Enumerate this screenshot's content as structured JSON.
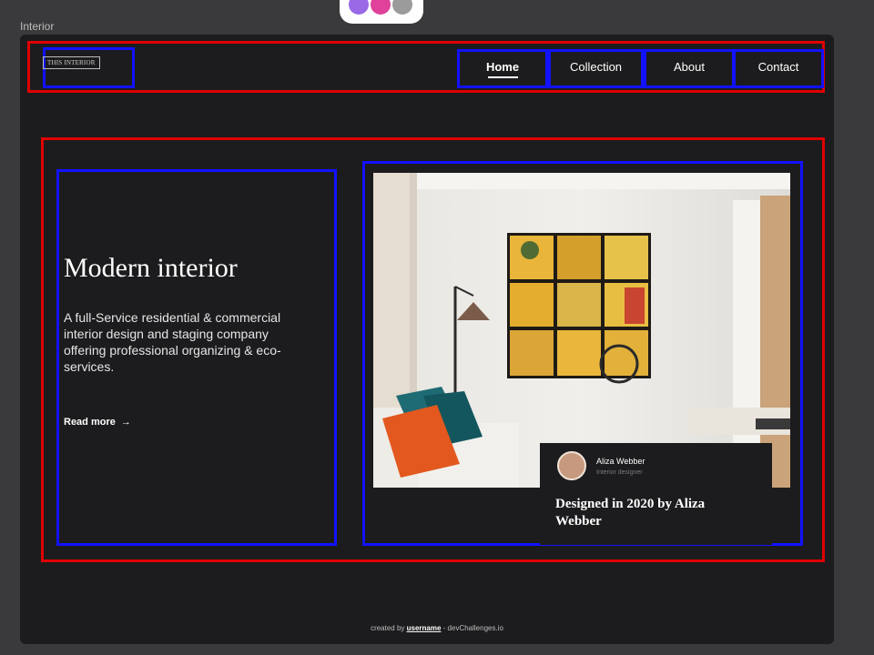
{
  "window": {
    "title": "Interior"
  },
  "nav": {
    "logo": "THIS INTERIOR",
    "items": [
      {
        "label": "Home",
        "active": true
      },
      {
        "label": "Collection",
        "active": false
      },
      {
        "label": "About",
        "active": false
      },
      {
        "label": "Contact",
        "active": false
      }
    ]
  },
  "hero": {
    "title": "Modern interior",
    "description": "A full-Service residential & commercial interior design and staging company offering professional organizing & eco-services.",
    "read_more": "Read more",
    "read_more_arrow": "→"
  },
  "feature": {
    "author_name": "Aliza Webber",
    "author_role": "Interior designer",
    "caption": "Designed in 2020 by Aliza Webber"
  },
  "footer": {
    "prefix": "created by ",
    "username": "username",
    "suffix": " - devChallenges.io"
  },
  "colors": {
    "page_bg": "#1c1c1e",
    "annotation_red": "#e00000",
    "annotation_blue": "#1212ff"
  }
}
